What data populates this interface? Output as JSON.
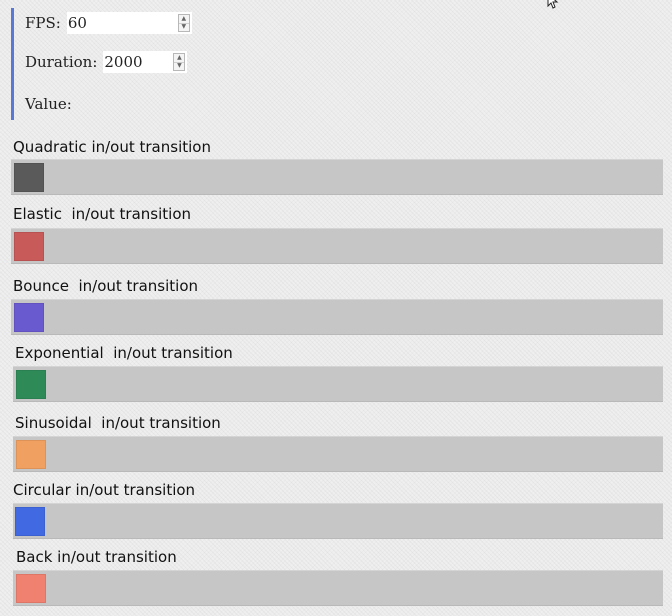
{
  "controls": {
    "fps_label": "FPS:",
    "fps_value": "60",
    "duration_label": "Duration:",
    "duration_value": "2000",
    "value_label": "Value:",
    "value_text": ""
  },
  "transitions": [
    {
      "id": "quadratic",
      "title": "Quadratic in/out transition",
      "color": "#5a5a5a"
    },
    {
      "id": "elastic",
      "title": "Elastic  in/out transition",
      "color": "#c85a5a"
    },
    {
      "id": "bounce",
      "title": "Bounce  in/out transition",
      "color": "#6a5ad0"
    },
    {
      "id": "exponential",
      "title": "Exponential  in/out transition",
      "color": "#2e8b57"
    },
    {
      "id": "sinusoidal",
      "title": "Sinusoidal  in/out transition",
      "color": "#f0a060"
    },
    {
      "id": "circular",
      "title": "Circular in/out transition",
      "color": "#4169e1"
    },
    {
      "id": "back",
      "title": "Back in/out transition",
      "color": "#f08070"
    }
  ],
  "icons": {
    "spin_up": "triangle-up",
    "spin_down": "triangle-down",
    "cursor": "arrow-pointer"
  }
}
